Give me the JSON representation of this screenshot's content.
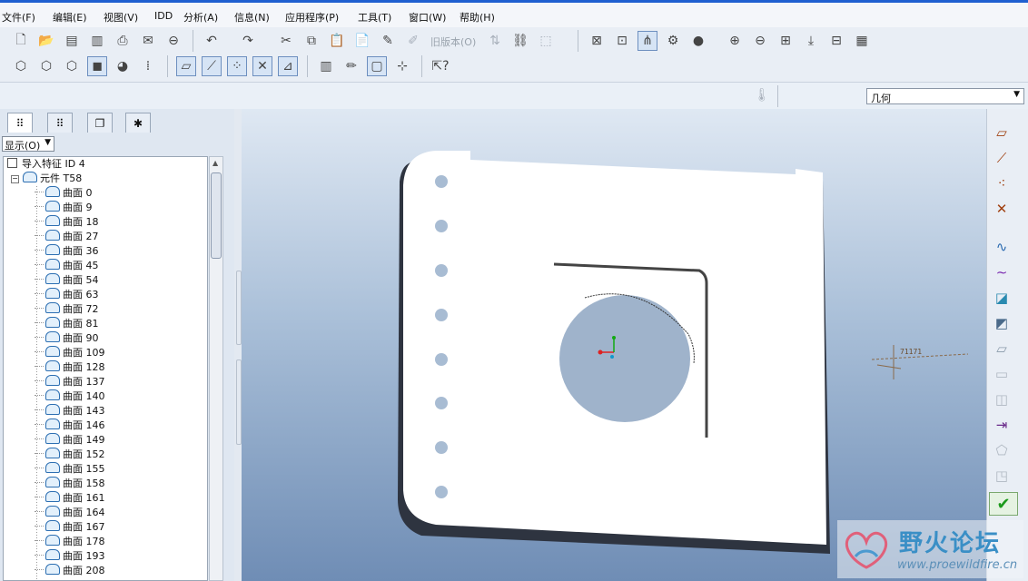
{
  "menu": [
    "文件(F)",
    "编辑(E)",
    "视图(V)",
    "IDD",
    "分析(A)",
    "信息(N)",
    "应用程序(P)",
    "工具(T)",
    "窗口(W)",
    "帮助(H)"
  ],
  "toolbar": {
    "revision_label": "旧版本(O)"
  },
  "filter": {
    "value": "几何"
  },
  "panel": {
    "show_label": "显示(O)"
  },
  "tree": {
    "root": "导入特征 ID 4",
    "component": "元件 T58",
    "surface_label": "曲面",
    "surfaces": [
      "0",
      "9",
      "18",
      "27",
      "36",
      "45",
      "54",
      "63",
      "72",
      "81",
      "90",
      "109",
      "128",
      "137",
      "140",
      "143",
      "146",
      "149",
      "152",
      "155",
      "158",
      "161",
      "164",
      "167",
      "178",
      "193",
      "208"
    ]
  },
  "viewport": {
    "annotation": "71171"
  },
  "watermark": {
    "name": "野火论坛",
    "url": "www.proewildfire.cn"
  },
  "colors": {
    "accent": "#1f5fd0",
    "part": "#ffffff",
    "ok": "#1c9a1c"
  }
}
